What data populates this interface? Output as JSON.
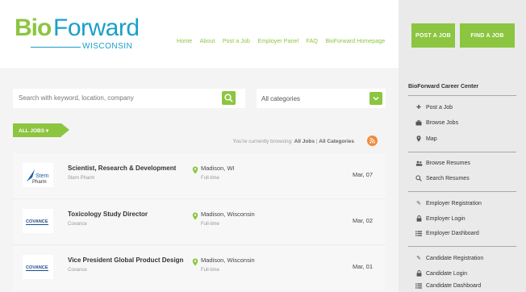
{
  "brand": {
    "logo_bio": "Bio",
    "logo_forward": "Forward",
    "logo_sub": "WISCONSIN",
    "colors": {
      "green": "#8cc53f",
      "blue": "#19a0c9"
    }
  },
  "nav": [
    "Home",
    "About",
    "Post a Job",
    "Employer Panel",
    "FAQ",
    "BioForward Homepage"
  ],
  "header_buttons": {
    "post": "POST A JOB",
    "find": "FIND A JOB"
  },
  "search": {
    "placeholder": "Search with keyword, location, company",
    "category": "All categories"
  },
  "tag": {
    "label": "ALL JOBS"
  },
  "browsing": {
    "prefix": "You're currently browsing:",
    "a": "All Jobs",
    "sep": " | ",
    "b": "All Categories"
  },
  "jobs": [
    {
      "logo_text": "Stem Pharm",
      "title": "Scientist, Research & Development",
      "company": "Stem Pharm",
      "location": "Madison, WI",
      "type": "Full-time",
      "date": "Mar, 07"
    },
    {
      "logo_text": "COVANCE",
      "title": "Toxicology Study Director",
      "company": "Covance",
      "location": "Madison, Wisconsin",
      "type": "Full-time",
      "date": "Mar, 02"
    },
    {
      "logo_text": "COVANCE",
      "title": "Vice President Global Product Design",
      "company": "Covance",
      "location": "Madison, Wisconsin",
      "type": "Full-time",
      "date": "Mar, 01"
    }
  ],
  "sidebar": {
    "title": "BioForward Career Center",
    "groups": [
      [
        {
          "icon": "plus-icon",
          "label": "Post a Job"
        },
        {
          "icon": "briefcase-icon",
          "label": "Browse Jobs"
        },
        {
          "icon": "map-pin-icon",
          "label": "Map"
        }
      ],
      [
        {
          "icon": "users-icon",
          "label": "Browse Resumes"
        },
        {
          "icon": "search-icon",
          "label": "Search Resumes"
        }
      ],
      [
        {
          "icon": "pencil-icon",
          "label": "Employer Registration"
        },
        {
          "icon": "lock-icon",
          "label": "Employer Login"
        },
        {
          "icon": "list-icon",
          "label": "Employer Dashboard"
        }
      ],
      [
        {
          "icon": "pencil-icon",
          "label": "Candidate Registration"
        },
        {
          "icon": "lock-icon",
          "label": "Candidate Login"
        },
        {
          "icon": "list-icon",
          "label": "Candidate Dashboard"
        }
      ]
    ]
  }
}
